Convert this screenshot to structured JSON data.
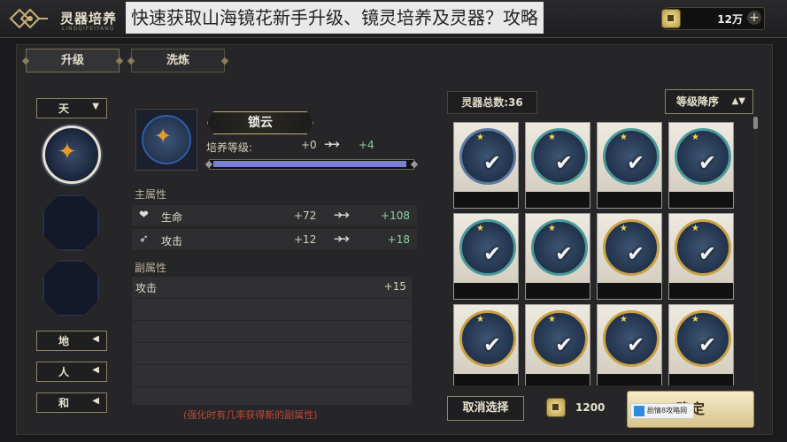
{
  "header": {
    "title": "灵器培养",
    "subtitle": "LINGQIPEIYANG",
    "overlay_text": "快速获取山海镜花新手升级、镜灵培养及灵器？攻略",
    "currency_value": "12万",
    "currency_plus": "+"
  },
  "tabs": [
    {
      "label": "升级",
      "active": true
    },
    {
      "label": "洗炼",
      "active": false
    }
  ],
  "grades": [
    {
      "label": "天",
      "arrow": "▼"
    },
    {
      "label": "地",
      "arrow": "◀"
    },
    {
      "label": "人",
      "arrow": "◀"
    },
    {
      "label": "和",
      "arrow": "◀"
    }
  ],
  "item": {
    "name": "锁云",
    "level_label": "培养等级:",
    "level_from": "+0",
    "level_arrow": "➔➔",
    "level_to": "+4",
    "progress": 0.98
  },
  "main_attrs": {
    "title": "主属性",
    "rows": [
      {
        "icon": "❤",
        "icon_name": "heart-icon",
        "name": "生命",
        "from": "+72",
        "arrow": "➔➔",
        "to": "+108"
      },
      {
        "icon": "➶",
        "icon_name": "attack-icon",
        "name": "攻击",
        "from": "+12",
        "arrow": "➔➔",
        "to": "+18"
      }
    ]
  },
  "sub_attrs": {
    "title": "副属性",
    "rows": [
      {
        "name": "攻击",
        "value": "+15"
      }
    ]
  },
  "note": "(强化时有几率获得新的副属性)",
  "right": {
    "total_label": "灵器总数:36",
    "sort_label": "等级降序",
    "sort_arrow": "▲▼",
    "cancel_label": "取消选择",
    "cost": "1200",
    "confirm_label": "确定",
    "check_glyph": "✔",
    "star_glyph": "★"
  },
  "watermark": {
    "text": "剧情8攻略网"
  },
  "colors": {
    "accent_gold": "#c8b27a",
    "bar_fill": "#7a7fd6",
    "gain_green": "#8ed0a0",
    "note_red": "#c0463a"
  }
}
